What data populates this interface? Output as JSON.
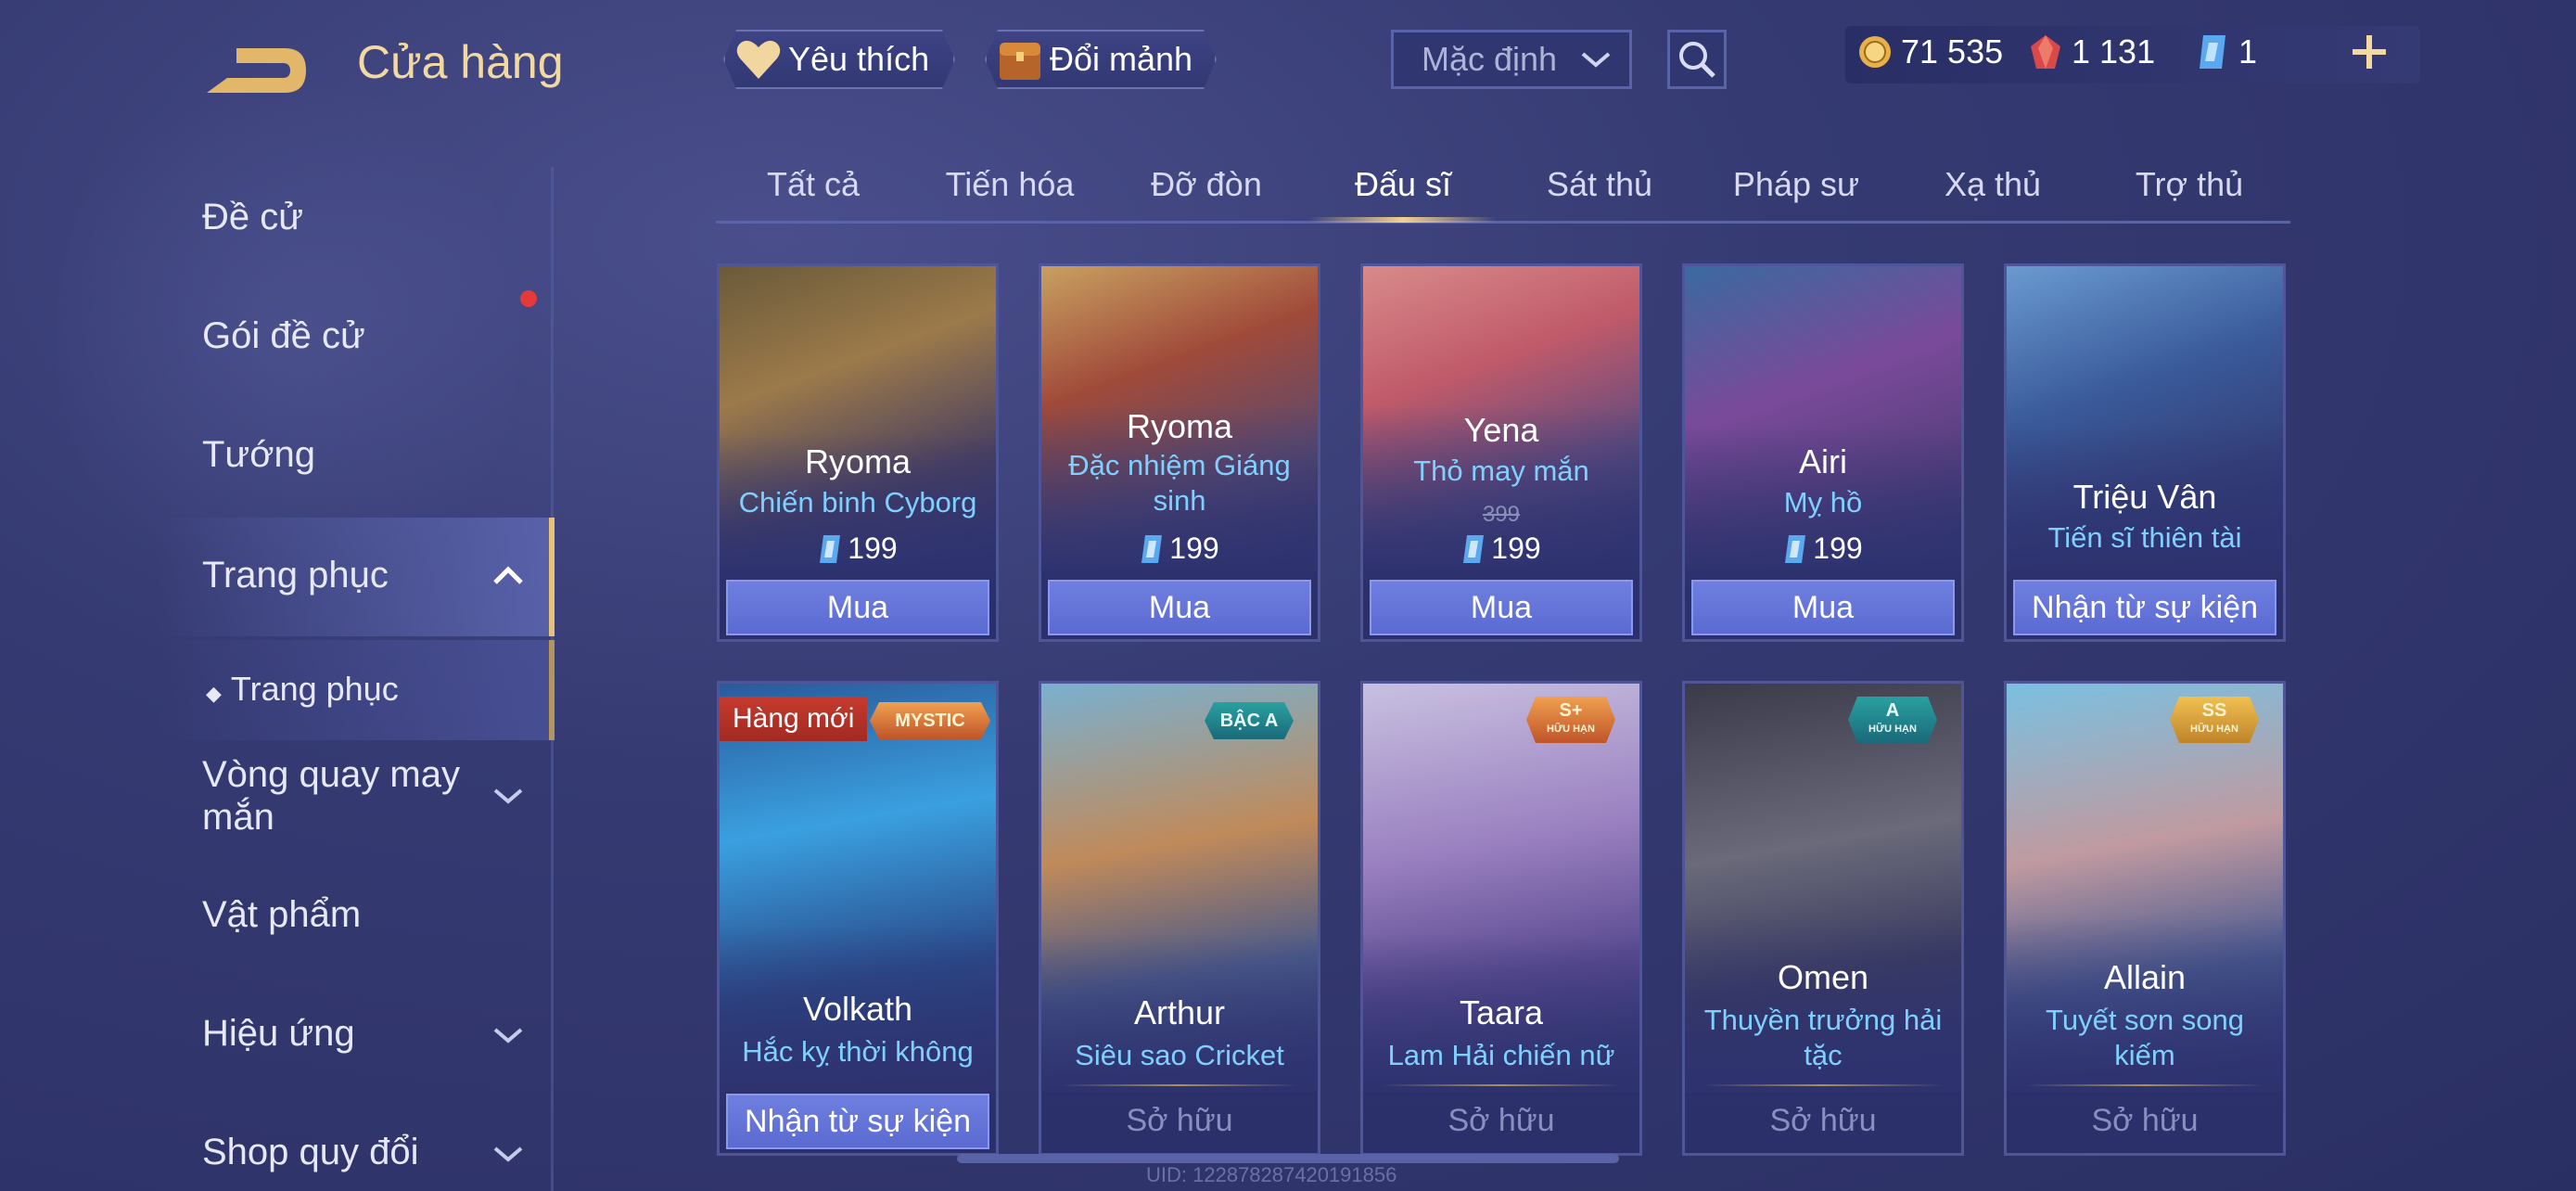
{
  "header": {
    "title": "Cửa hàng",
    "favorites_label": "Yêu thích",
    "exchange_label": "Đổi mảnh",
    "sort_value": "Mặc định"
  },
  "currency": {
    "gold": "71 535",
    "ruby": "1 131",
    "voucher": "1"
  },
  "sidebar": {
    "items": [
      {
        "label": "Đề cử"
      },
      {
        "label": "Gói đề cử"
      },
      {
        "label": "Tướng"
      },
      {
        "label": "Trang phục"
      },
      {
        "label": "Trang phục"
      },
      {
        "label": "Vòng quay may mắn"
      },
      {
        "label": "Vật phẩm"
      },
      {
        "label": "Hiệu ứng"
      },
      {
        "label": "Shop quy đổi"
      }
    ]
  },
  "tabs": [
    {
      "label": "Tất cả"
    },
    {
      "label": "Tiến hóa"
    },
    {
      "label": "Đỡ đòn"
    },
    {
      "label": "Đấu sĩ"
    },
    {
      "label": "Sát thủ"
    },
    {
      "label": "Pháp sư"
    },
    {
      "label": "Xạ thủ"
    },
    {
      "label": "Trợ thủ"
    }
  ],
  "cards": [
    {
      "hero": "Ryoma",
      "skin": "Chiến binh Cyborg",
      "price": "199",
      "action": "Mua"
    },
    {
      "hero": "Ryoma",
      "skin": "Đặc nhiệm Giáng sinh",
      "price": "199",
      "action": "Mua"
    },
    {
      "hero": "Yena",
      "skin": "Thỏ may mắn",
      "old_price": "399",
      "price": "199",
      "action": "Mua"
    },
    {
      "hero": "Airi",
      "skin": "Mỵ hồ",
      "price": "199",
      "action": "Mua"
    },
    {
      "hero": "Triệu Vân",
      "skin": "Tiến sĩ thiên tài",
      "action": "Nhận từ sự kiện"
    },
    {
      "hero": "Volkath",
      "skin": "Hắc kỵ thời không",
      "action": "Nhận từ sự kiện",
      "badge_new": "Hàng mới",
      "tier": "MYSTIC"
    },
    {
      "hero": "Arthur",
      "skin": "Siêu sao Cricket",
      "status": "Sở hữu",
      "tier": "BẬC A"
    },
    {
      "hero": "Taara",
      "skin": "Lam Hải chiến nữ",
      "status": "Sở hữu",
      "tier": "S+",
      "tier_sub": "HỮU HẠN"
    },
    {
      "hero": "Omen",
      "skin": "Thuyền trưởng hải tặc",
      "status": "Sở hữu",
      "tier": "A",
      "tier_sub": "HỮU HẠN"
    },
    {
      "hero": "Allain",
      "skin": "Tuyết sơn song kiếm",
      "status": "Sở hữu",
      "tier": "SS",
      "tier_sub": "HỮU HẠN"
    }
  ],
  "footer": {
    "uid": "UID: 122878287420191856"
  },
  "colors": {
    "accent_gold": "#f2d9a2",
    "skin_text": "#7fd0ff",
    "buy_button": "#6a7ad8",
    "new_badge": "#c63a2e"
  }
}
